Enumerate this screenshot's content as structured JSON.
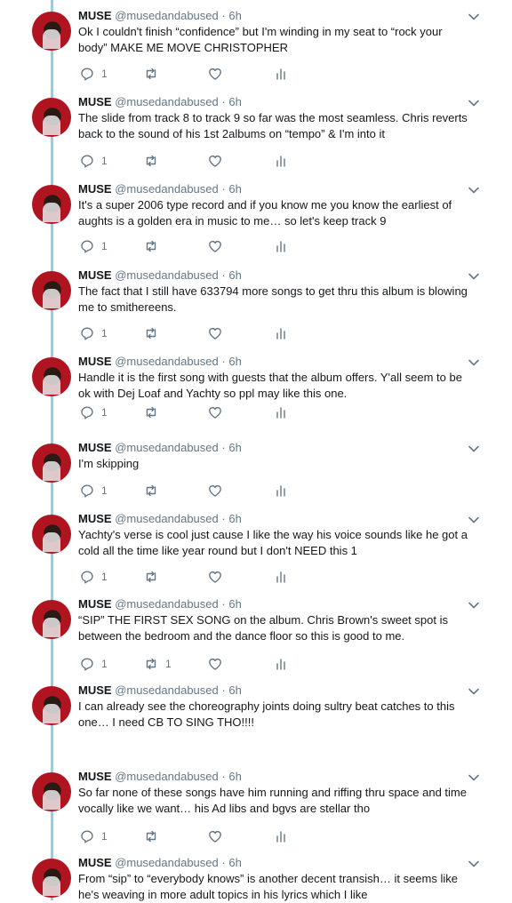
{
  "tweets": [
    {
      "name": "MUSE",
      "handle": "@musedandabused",
      "dot": "·",
      "time": "6h",
      "text": "Ok I couldn't finish “confidence” but I'm winding in my seat to “rock your body” MAKE ME MOVE CHRISTOPHER",
      "replies": "1",
      "retweets": "",
      "likes": ""
    },
    {
      "name": "MUSE",
      "handle": "@musedandabused",
      "dot": "·",
      "time": "6h",
      "text": "The slide from track 8 to track 9 so far was the most seamless. Chris reverts back to the sound of his 1st 2albums on “tempo” & I'm into it",
      "replies": "1",
      "retweets": "",
      "likes": ""
    },
    {
      "name": "MUSE",
      "handle": "@musedandabused",
      "dot": "·",
      "time": "6h",
      "text": "It's a super 2006 type record and if you know me you know the earliest of aughts is a golden era in music to me… so let's keep track 9",
      "replies": "1",
      "retweets": "",
      "likes": ""
    },
    {
      "name": "MUSE",
      "handle": "@musedandabused",
      "dot": "·",
      "time": "6h",
      "text": "The fact that I still have 633794 more songs to get thru this album is blowing me to smithereens.",
      "replies": "1",
      "retweets": "",
      "likes": ""
    },
    {
      "name": "MUSE",
      "handle": "@musedandabused",
      "dot": "·",
      "time": "6h",
      "text": "Handle it is the first song with guests that the album offers. Y'all seem to be ok with Dej Loaf and Yachty so ppl may like this one.",
      "replies": "1",
      "retweets": "",
      "likes": ""
    },
    {
      "name": "MUSE",
      "handle": "@musedandabused",
      "dot": "·",
      "time": "6h",
      "text": "I'm skipping",
      "replies": "1",
      "retweets": "",
      "likes": ""
    },
    {
      "name": "MUSE",
      "handle": "@musedandabused",
      "dot": "·",
      "time": "6h",
      "text": "Yachty's verse is cool just cause I like the way his voice sounds like he got a cold all the time like year round but I don't NEED this 1",
      "replies": "1",
      "retweets": "",
      "likes": ""
    },
    {
      "name": "MUSE",
      "handle": "@musedandabused",
      "dot": "·",
      "time": "6h",
      "text": "“SIP” THE FIRST SEX SONG on the album. Chris Brown's sweet spot is between the bedroom and the dance floor so this is good to me.",
      "replies": "1",
      "retweets": "1",
      "likes": ""
    },
    {
      "name": "MUSE",
      "handle": "@musedandabused",
      "dot": "·",
      "time": "6h",
      "text": "I can already see the choreography joints doing sultry beat catches to this one… I need CB TO SING THO!!!!",
      "replies": "",
      "retweets": "",
      "likes": ""
    },
    {
      "name": "MUSE",
      "handle": "@musedandabused",
      "dot": "·",
      "time": "6h",
      "text": "So far none of these songs have him running and riffing thru space and time vocally like we want… his Ad libs and bgvs are stellar tho",
      "replies": "1",
      "retweets": "",
      "likes": ""
    },
    {
      "name": "MUSE",
      "handle": "@musedandabused",
      "dot": "·",
      "time": "6h",
      "text": "From “sip” to “everybody knows” is another decent transish… it seems like he's weaving in more adult topics in his lyrics which I like",
      "replies": "",
      "retweets": "",
      "likes": ""
    }
  ]
}
